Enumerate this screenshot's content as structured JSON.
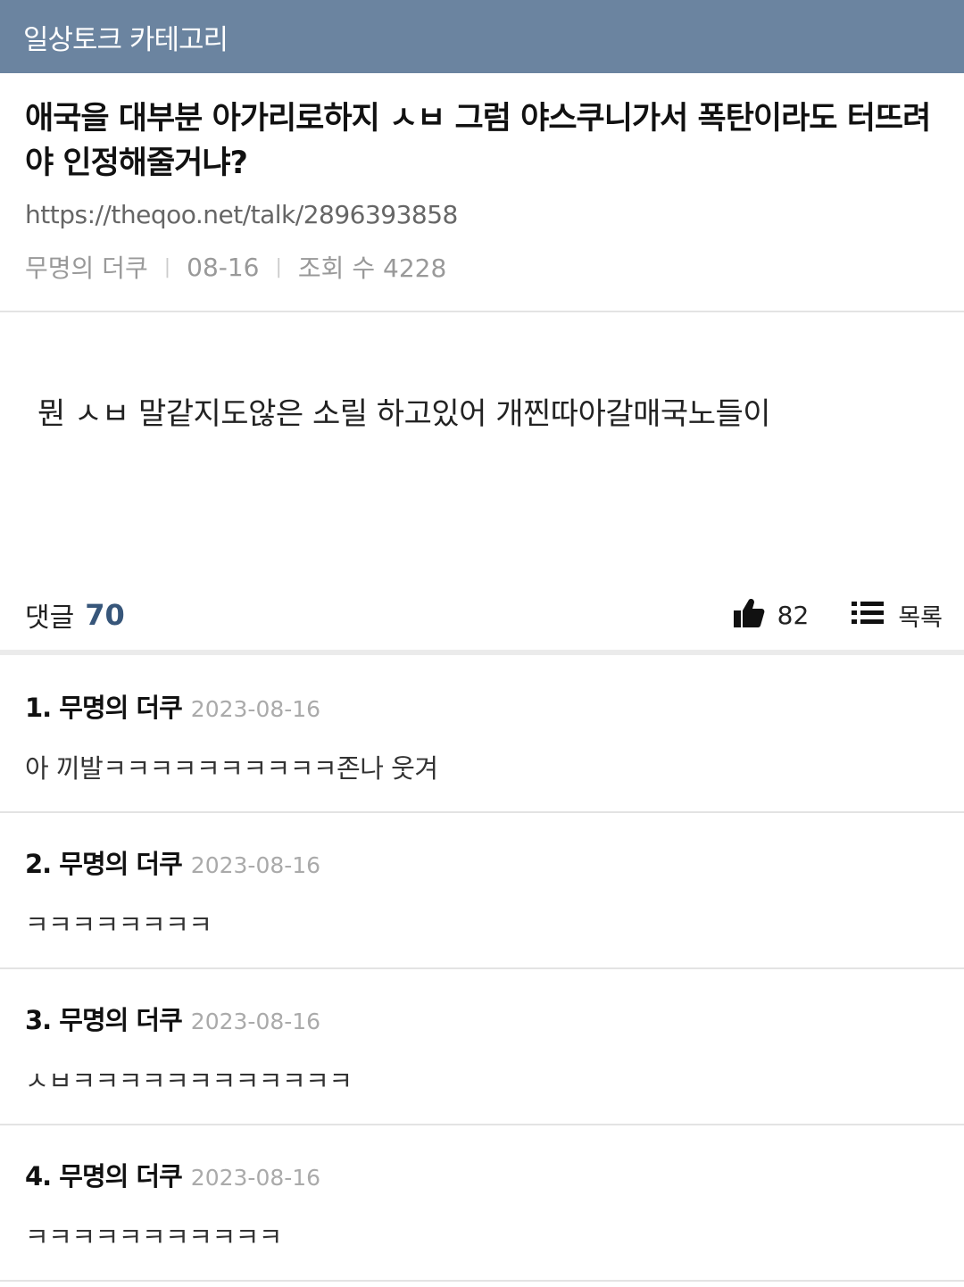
{
  "header": {
    "category": "일상토크 카테고리"
  },
  "post": {
    "title": "애국을 대부분 아가리로하지 ㅅㅂ 그럼 야스쿠니가서 폭탄이라도 터뜨려야 인정해줄거냐?",
    "url": "https://theqoo.net/talk/2896393858",
    "author": "무명의 더쿠",
    "date": "08-16",
    "views": "조회 수 4228",
    "body": "뭔 ㅅㅂ 말같지도않은 소릴 하고있어 개찐따아갈매국노들이"
  },
  "actions": {
    "comments_label": "댓글",
    "comments_count": "70",
    "like_icon": "thumbs-up-icon",
    "like_count": "82",
    "list_icon": "list-icon",
    "list_label": "목록"
  },
  "comments": [
    {
      "author": "1. 무명의 더쿠",
      "date": "2023-08-16",
      "text": "아 끼발ㅋㅋㅋㅋㅋㅋㅋㅋㅋㅋ존나 웃겨"
    },
    {
      "author": "2. 무명의 더쿠",
      "date": "2023-08-16",
      "text": "ㅋㅋㅋㅋㅋㅋㅋㅋ"
    },
    {
      "author": "3. 무명의 더쿠",
      "date": "2023-08-16",
      "text": "ㅅㅂㅋㅋㅋㅋㅋㅋㅋㅋㅋㅋㅋㅋ"
    },
    {
      "author": "4. 무명의 더쿠",
      "date": "2023-08-16",
      "text": "ㅋㅋㅋㅋㅋㅋㅋㅋㅋㅋㅋ"
    }
  ],
  "colors": {
    "header_bg": "#6b84a0",
    "comment_count": "#37567a"
  }
}
